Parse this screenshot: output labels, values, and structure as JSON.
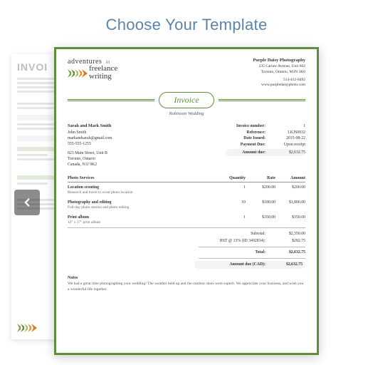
{
  "heading": "Choose Your Template",
  "behind_label": "INVOI",
  "logo": {
    "line1": "adventures",
    "line1_suffix": "in",
    "line2": "freelance",
    "line3": "writing"
  },
  "company": {
    "name": "Purple Daisy Photography",
    "addr1": "235 Carlaw Avenue, Unit 602",
    "addr2": "Toronto, Ontario, M3N 3K0",
    "phone": "514-412-8492",
    "site": "www.purpledaisyphoto.com"
  },
  "invoice_title": "Invoice",
  "subtitle": "Robinson Wedding",
  "bill_to": {
    "name": "Sarah and Mark Smith",
    "contact": "John Smith",
    "email": "markandsarah@gmail.com",
    "phone": "555-555-1255",
    "addr1": "823 Main Street, Unit B",
    "addr2": "Toronto, Ontario",
    "addr3": "Canada, N1J 9K2"
  },
  "meta": {
    "labels": {
      "number": "Invoice number:",
      "reference": "Reference:",
      "issued": "Date Issued:",
      "due": "Payment Due:",
      "amount": "Amount due:"
    },
    "number": "1",
    "reference": "LKJS0932",
    "issued": "2015-08-22",
    "due": "Upon receipt",
    "amount": "$2,632.75"
  },
  "columns": {
    "service": "Photo Services",
    "qty": "Quantity",
    "rate": "Rate",
    "amount": "Amount"
  },
  "items": [
    {
      "name": "Location scouting",
      "desc": "Research and travel to scout photo location",
      "qty": "1",
      "rate": "$200.00",
      "amount": "$200.00"
    },
    {
      "name": "Photography and editing",
      "desc": "Full-day photo session and photo editing",
      "qty": "10",
      "rate": "$180.00",
      "amount": "$1,800.00"
    },
    {
      "name": "Print album",
      "desc": "12\" x 17\" print album",
      "qty": "1",
      "rate": "$350.00",
      "amount": "$350.00"
    }
  ],
  "totals": {
    "subtotal_label": "Subtotal:",
    "subtotal": "$2,350.00",
    "tax_label": "HST @ 13% (ID 3492834):",
    "tax": "$282.75",
    "total_label": "Total:",
    "total": "$2,632.75",
    "grand_label": "Amount due (CAD):",
    "grand": "$2,632.75"
  },
  "notes": {
    "heading": "Notes",
    "body": "We had a great time photographing your wedding! The weather held up and the outdoor shots were superb. We appreciate your business, and wish you a wonderful life together."
  }
}
